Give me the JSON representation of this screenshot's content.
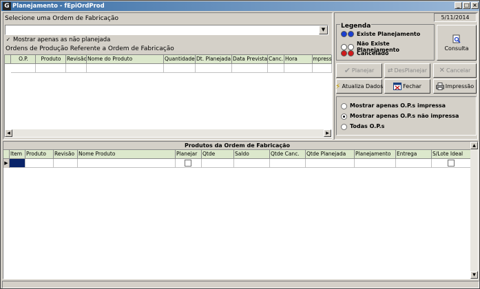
{
  "window": {
    "title": "Planejamento - fEpiOrdProd",
    "min": "_",
    "max": "□",
    "close": "×"
  },
  "app_icon": "G",
  "select_order": {
    "label": "Selecione uma Ordem de Fabricação",
    "value": ""
  },
  "filter_checkbox": {
    "label": "Mostrar apenas as não planejada",
    "checked": true
  },
  "orders_section": {
    "label": "Ordens de Produção Referente a Ordem de Fabricação",
    "columns": [
      "O.P.",
      "Produto",
      "Revisão",
      "Nome do Produto",
      "Quantidade",
      "Dt. Planejada",
      "Data Prevista",
      "Canc.",
      "Hora",
      "Impresso"
    ]
  },
  "date": "5/11/2014",
  "legend": {
    "title": "Legenda",
    "items": [
      {
        "label": "Existe Planejamento",
        "color": "#1a3fd0"
      },
      {
        "label": "Não Existe Planejamento",
        "color": "#ffffff"
      },
      {
        "label": "Cancelado",
        "color": "#d01a1a"
      }
    ]
  },
  "buttons": {
    "consulta": "Consulta",
    "planejar": "Planejar",
    "desplanejar": "DesPlanejar",
    "cancelar": "Cancelar",
    "atualiza": "Atualiza Dados",
    "fechar": "Fechar",
    "impressao": "Impressão"
  },
  "print_filter": {
    "options": [
      "Mostrar apenas O.P.s impressa",
      "Mostrar apenas O.P.s não impressa",
      "Todas O.P.s"
    ],
    "selected": 1
  },
  "products_section": {
    "title": "Produtos da Ordem de Fabricação",
    "columns": [
      "Item",
      "Produto",
      "Revisão",
      "Nome Produto",
      "Planejar",
      "Qtde",
      "Saldo",
      "Qtde Canc.",
      "Qtde Planejada",
      "Planejamento",
      "Entrega",
      "S/Lote Ideal"
    ]
  },
  "icons": {
    "consulta": "search-document-icon",
    "planejar": "check-icon",
    "desplanejar": "unplan-icon",
    "cancelar": "x-icon",
    "atualiza": "lightning-icon",
    "fechar": "close-window-icon",
    "impressao": "printer-icon"
  }
}
